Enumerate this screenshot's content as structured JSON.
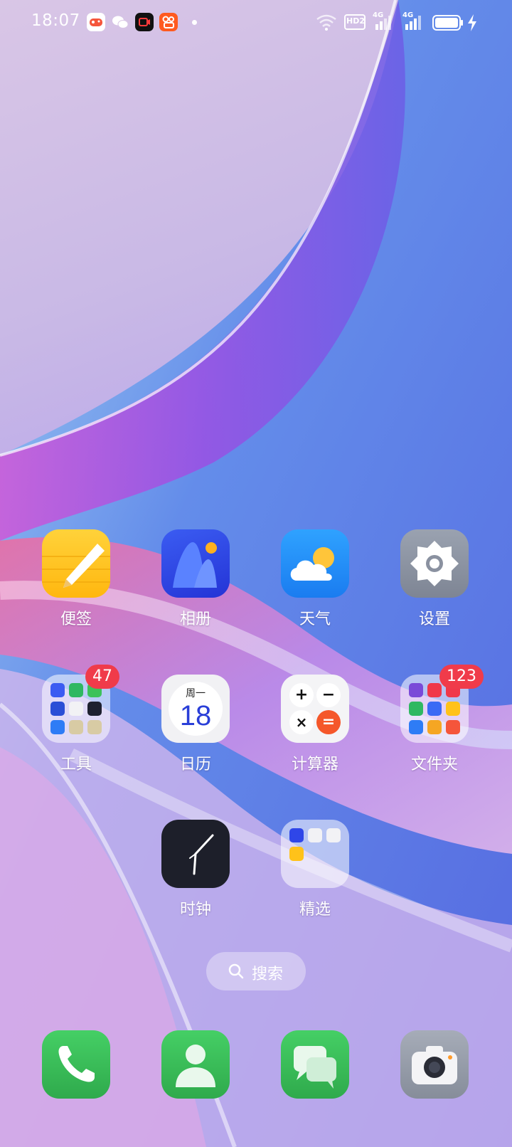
{
  "status_bar": {
    "time": "18:07",
    "notification_icons": [
      "game-center-icon",
      "wechat-icon",
      "screen-record-icon",
      "kuaishou-icon"
    ],
    "network_badge": "HD2",
    "signal_1_label": "4G",
    "signal_2_label": "4G"
  },
  "apps_row1": [
    {
      "label": "便签",
      "icon": "notes-icon"
    },
    {
      "label": "相册",
      "icon": "photos-icon"
    },
    {
      "label": "天气",
      "icon": "weather-icon"
    },
    {
      "label": "设置",
      "icon": "settings-icon"
    }
  ],
  "apps_row2": [
    {
      "label": "工具",
      "icon": "tools-folder-icon",
      "badge": "47"
    },
    {
      "label": "日历",
      "icon": "calendar-icon",
      "weekday": "周一",
      "day": "18"
    },
    {
      "label": "计算器",
      "icon": "calculator-icon",
      "symbols": [
        "+",
        "−",
        "×",
        "="
      ]
    },
    {
      "label": "文件夹",
      "icon": "folder-icon",
      "badge": "123"
    }
  ],
  "apps_row3": [
    {
      "label": "时钟",
      "icon": "clock-icon"
    },
    {
      "label": "精选",
      "icon": "featured-folder-icon"
    }
  ],
  "search": {
    "label": "搜索"
  },
  "dock": [
    {
      "icon": "phone-icon"
    },
    {
      "icon": "contacts-icon"
    },
    {
      "icon": "messages-icon"
    },
    {
      "icon": "camera-icon"
    }
  ],
  "colors": {
    "notes": "#ffc21a",
    "photos": "#2f46e8",
    "weather": "#2b8cf5",
    "settings": "#8e95a3",
    "calculator_equals": "#f5572a",
    "badge": "#f03b4a",
    "dock_green": "#3cc25a",
    "camera": "#9aa0ab"
  }
}
